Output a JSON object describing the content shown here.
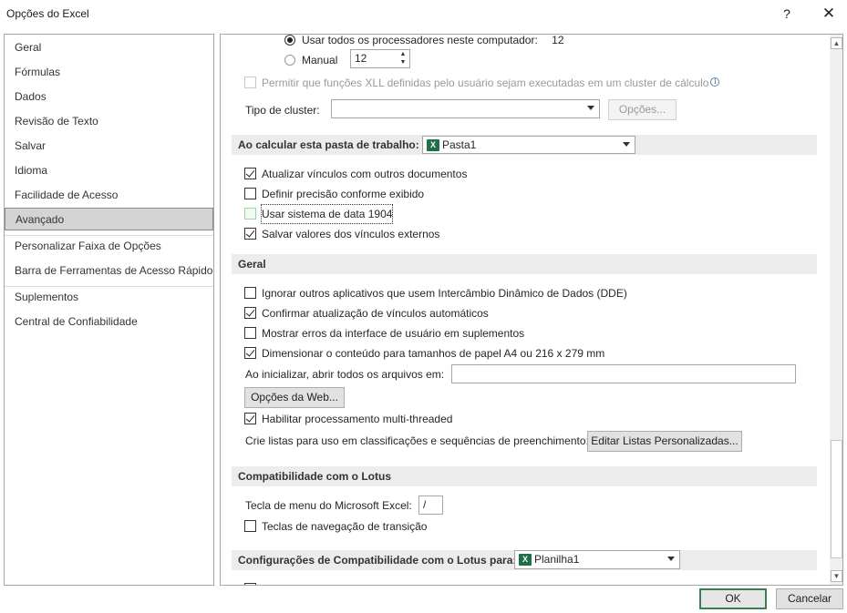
{
  "window": {
    "title": "Opções do Excel",
    "help": "?",
    "close": "✕"
  },
  "sidebar": {
    "items": [
      {
        "label": "Geral"
      },
      {
        "label": "Fórmulas"
      },
      {
        "label": "Dados"
      },
      {
        "label": "Revisão de Texto"
      },
      {
        "label": "Salvar"
      },
      {
        "label": "Idioma"
      },
      {
        "label": "Facilidade de Acesso"
      },
      {
        "label": "Avançado"
      },
      {
        "label": "Personalizar Faixa de Opções"
      },
      {
        "label": "Barra de Ferramentas de Acesso Rápido"
      },
      {
        "label": "Suplementos"
      },
      {
        "label": "Central de Confiabilidade"
      }
    ],
    "selected": "Avançado"
  },
  "formulas": {
    "use_all_processors": "Usar todos os processadores neste computador:",
    "processors_count": "12",
    "manual_label": "Manual",
    "manual_value": "12",
    "allow_xll": "Permitir que funções XLL definidas pelo usuário sejam executadas em um cluster de cálculo",
    "cluster_type_label": "Tipo de cluster:",
    "cluster_type_value": "",
    "options_button": "Opções..."
  },
  "calc_section": {
    "header": "Ao calcular esta pasta de trabalho:",
    "workbook": "Pasta1",
    "items": [
      {
        "label": "Atualizar vínculos com outros documentos",
        "checked": true
      },
      {
        "label": "Definir precisão conforme exibido",
        "checked": false
      },
      {
        "label": "Usar sistema de data 1904",
        "checked": false
      },
      {
        "label": "Salvar valores dos vínculos externos",
        "checked": true
      }
    ]
  },
  "general_section": {
    "header": "Geral",
    "items": [
      {
        "label": "Ignorar outros aplicativos que usem Intercâmbio Dinâmico de Dados (DDE)",
        "checked": false
      },
      {
        "label": "Confirmar atualização de vínculos automáticos",
        "checked": true
      },
      {
        "label": "Mostrar erros da interface de usuário em suplementos",
        "checked": false
      },
      {
        "label": "Dimensionar o conteúdo para tamanhos de papel A4 ou 216 x 279 mm",
        "checked": true
      }
    ],
    "startup_label": "Ao inicializar, abrir todos os arquivos em:",
    "startup_value": "",
    "web_options_button": "Opções da Web...",
    "multithreaded": {
      "label": "Habilitar processamento multi-threaded",
      "checked": true
    },
    "custom_lists_label": "Crie listas para uso em classificações e sequências de preenchimento:",
    "custom_lists_button": "Editar Listas Personalizadas..."
  },
  "lotus_section": {
    "header": "Compatibilidade com o Lotus",
    "menu_key_label": "Tecla de menu do Microsoft Excel:",
    "menu_key_value": "/",
    "transition_nav": {
      "label": "Teclas de navegação de transição",
      "checked": false
    }
  },
  "lotus_settings_section": {
    "header": "Configurações de Compatibilidade com o Lotus para:",
    "sheet": "Planilha1"
  },
  "footer": {
    "ok": "OK",
    "cancel": "Cancelar"
  },
  "colors": {
    "ok_border": "#3a7f52",
    "excel_icon": "#1e7145",
    "section_bg": "#ececec",
    "selected_nav": "#d4d4d4"
  }
}
